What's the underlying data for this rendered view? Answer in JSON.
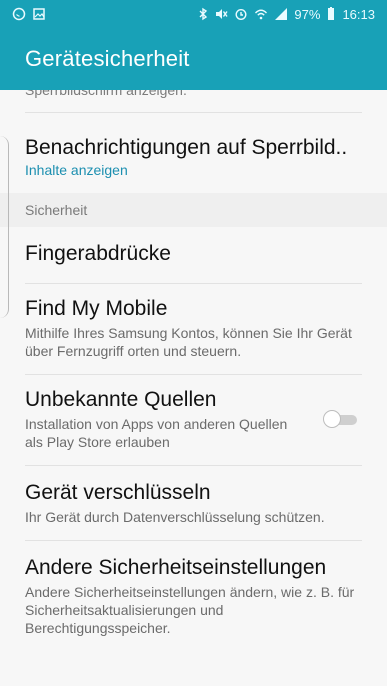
{
  "status_bar": {
    "left_icons": [
      "whatsapp-icon",
      "image-icon"
    ],
    "right_icons": [
      "bluetooth-icon",
      "mute-icon",
      "alarm-icon",
      "wifi-icon",
      "signal-icon"
    ],
    "battery": "97%",
    "time": "16:13"
  },
  "app_bar": {
    "title": "Gerätesicherheit"
  },
  "cut_text": "Sperrbildschirm anzeigen.",
  "items": {
    "notifications": {
      "title": "Benachrichtigungen auf Sperrbild..",
      "subtitle": "Inhalte anzeigen"
    },
    "section_security": "Sicherheit",
    "fingerprints": {
      "title": "Fingerabdrücke"
    },
    "find_my_mobile": {
      "title": "Find My Mobile",
      "subtitle": "Mithilfe Ihres Samsung Kontos, können Sie Ihr Gerät über Fernzugriff orten und steuern."
    },
    "unknown_sources": {
      "title": "Unbekannte Quellen",
      "subtitle": "Installation von Apps von anderen Quellen als Play Store erlauben",
      "enabled": false
    },
    "encrypt": {
      "title": "Gerät verschlüsseln",
      "subtitle": "Ihr Gerät durch Datenverschlüsselung schützen."
    },
    "other_security": {
      "title": "Andere Sicherheitseinstellungen",
      "subtitle": "Andere Sicherheitseinstellungen ändern, wie z. B. für Sicherheitsaktualisierungen und Berechtigungsspeicher."
    }
  },
  "colors": {
    "accent": "#18a1b7",
    "link": "#1c8fb0"
  }
}
